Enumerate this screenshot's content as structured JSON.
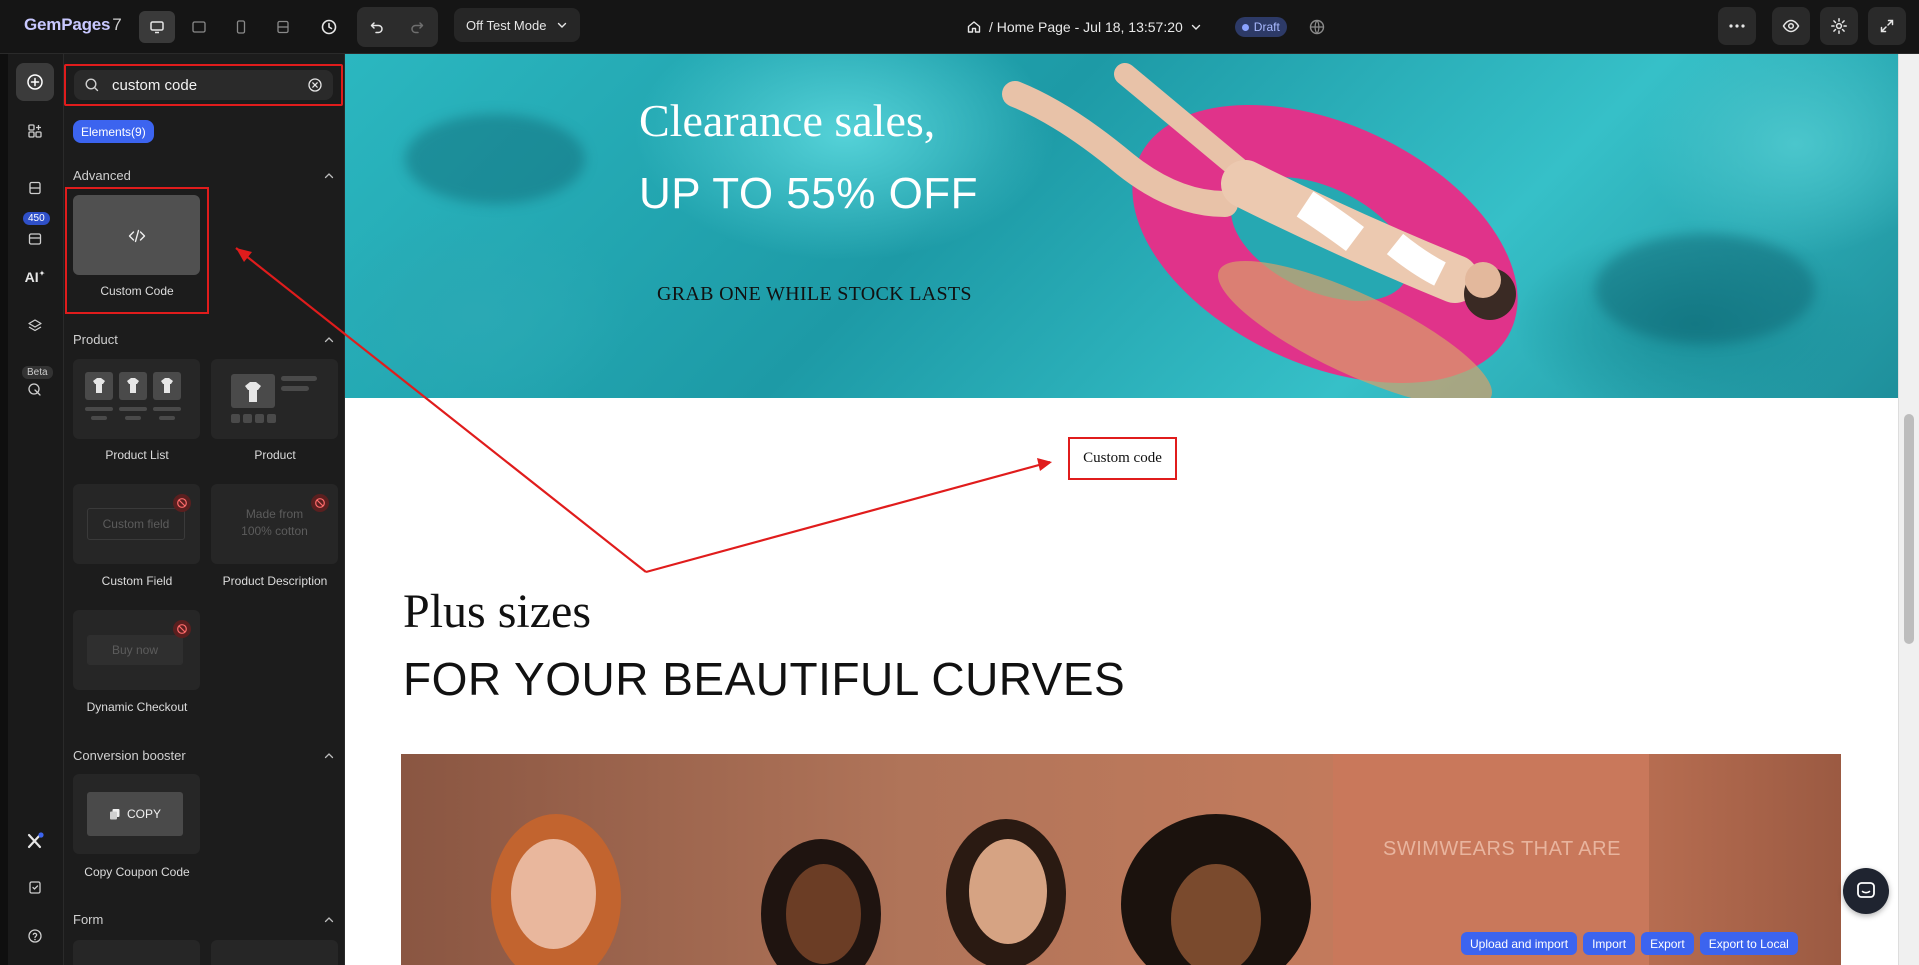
{
  "app": {
    "logo": "GemPages",
    "version": "7"
  },
  "toolbar": {
    "mode_label": "Off Test Mode",
    "page_title": "/ Home Page - Jul 18, 13:57:20",
    "status_badge": "Draft"
  },
  "rail": {
    "badge_count": "450",
    "ai_label": "AI",
    "beta_label": "Beta"
  },
  "panel": {
    "search_value": "custom code",
    "search_placeholder": "Search",
    "filter_chip": "Elements(9)",
    "sections": {
      "advanced": "Advanced",
      "product": "Product",
      "conversion": "Conversion booster",
      "form": "Form"
    },
    "elements": {
      "custom_code": "Custom Code",
      "product_list": "Product List",
      "product": "Product",
      "custom_field": "Custom Field",
      "custom_field_ghost": "Custom field",
      "product_description": "Product Description",
      "product_description_ghost_1": "Made from",
      "product_description_ghost_2": "100% cotton",
      "dynamic_checkout": "Dynamic Checkout",
      "dynamic_checkout_ghost": "Buy now",
      "copy_coupon": "Copy Coupon Code",
      "copy_button": "COPY"
    }
  },
  "canvas": {
    "hero_title": "Clearance sales,",
    "hero_subtitle": "UP TO 55% OFF",
    "hero_tagline": "GRAB ONE WHILE STOCK LASTS",
    "custom_code_text": "Custom code",
    "plus_title": "Plus sizes",
    "plus_subtitle": "FOR YOUR BEAUTIFUL CURVES",
    "swimwear_text": "SWIMWEARS THAT ARE"
  },
  "export_bar": {
    "upload_import": "Upload and import",
    "import": "Import",
    "export": "Export",
    "export_local": "Export to Local"
  },
  "colors": {
    "accent": "#3c64ef",
    "highlight": "#e01c1c",
    "panel_bg": "#1c1c1c"
  }
}
